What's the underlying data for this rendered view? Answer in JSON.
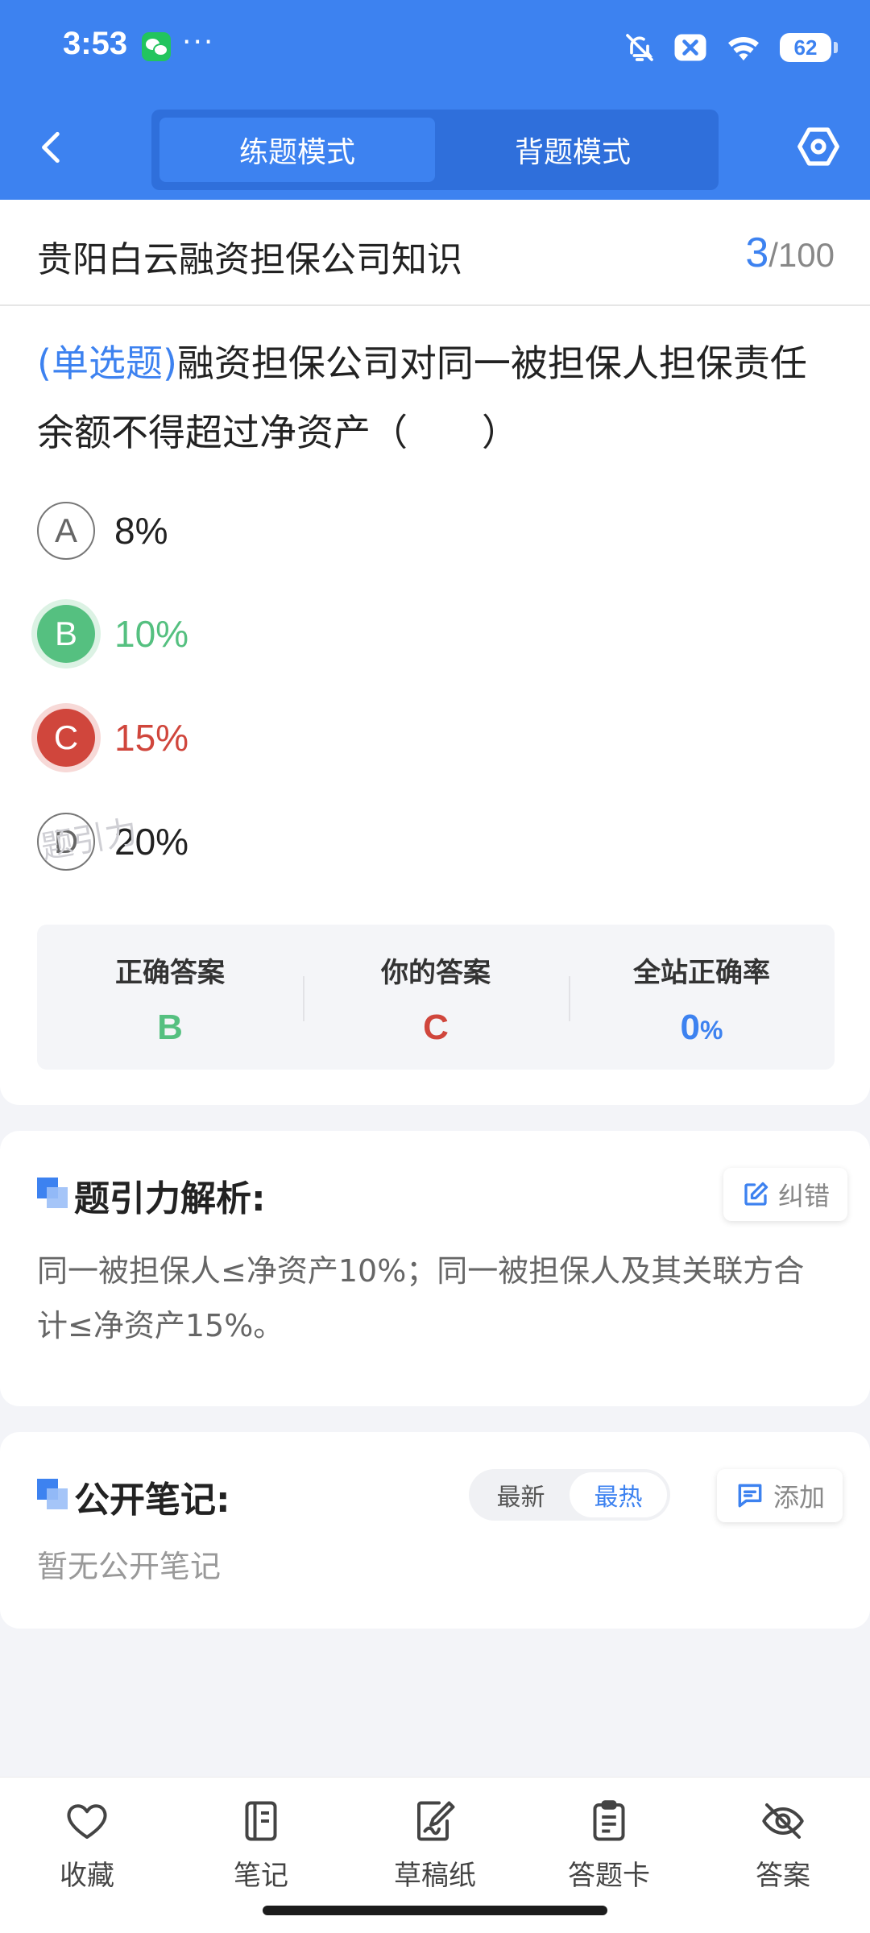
{
  "status_bar": {
    "time": "3:53",
    "dots": "···",
    "battery": "62",
    "icons": [
      "wechat-icon",
      "bell-off-icon",
      "close-box-icon",
      "wifi-icon",
      "battery-icon"
    ]
  },
  "nav": {
    "back_icon": "chevron-left-icon",
    "tabs": [
      {
        "label": "练题模式",
        "active": true
      },
      {
        "label": "背题模式",
        "active": false
      }
    ],
    "settings_icon": "hexagon-settings-icon"
  },
  "question": {
    "category": "贵阳白云融资担保公司知识",
    "current": "3",
    "separator": "/",
    "total": "100",
    "type_label": "(单选题)",
    "text": "融资担保公司对同一被担保人担保责任余额不得超过净资产（　　）",
    "options": [
      {
        "letter": "A",
        "text": "8%",
        "state": "normal"
      },
      {
        "letter": "B",
        "text": "10%",
        "state": "correct"
      },
      {
        "letter": "C",
        "text": "15%",
        "state": "wrong"
      },
      {
        "letter": "D",
        "text": "20%",
        "state": "normal"
      }
    ],
    "answer_summary": {
      "correct_label": "正确答案",
      "correct_value": "B",
      "yours_label": "你的答案",
      "yours_value": "C",
      "rate_label": "全站正确率",
      "rate_value": "0",
      "rate_unit": "%"
    },
    "watermark": "题引力"
  },
  "analysis": {
    "title": "题引力解析:",
    "report_button": "纠错",
    "report_icon": "edit-icon",
    "text": "同一被担保人≤净资产10%；同一被担保人及其关联方合计≤净资产15%。"
  },
  "notes": {
    "title": "公开笔记:",
    "sort_tabs": [
      {
        "label": "最新",
        "active": false
      },
      {
        "label": "最热",
        "active": true
      }
    ],
    "add_button": "添加",
    "add_icon": "comment-icon",
    "empty_text": "暂无公开笔记"
  },
  "bottom_bar": [
    {
      "label": "收藏",
      "icon": "heart-icon"
    },
    {
      "label": "笔记",
      "icon": "notebook-icon"
    },
    {
      "label": "草稿纸",
      "icon": "draft-pen-icon"
    },
    {
      "label": "答题卡",
      "icon": "clipboard-icon"
    },
    {
      "label": "答案",
      "icon": "eye-off-icon"
    }
  ],
  "colors": {
    "primary": "#3d82f0",
    "correct": "#55c080",
    "wrong": "#d0463c",
    "background": "#f3f4f8"
  }
}
